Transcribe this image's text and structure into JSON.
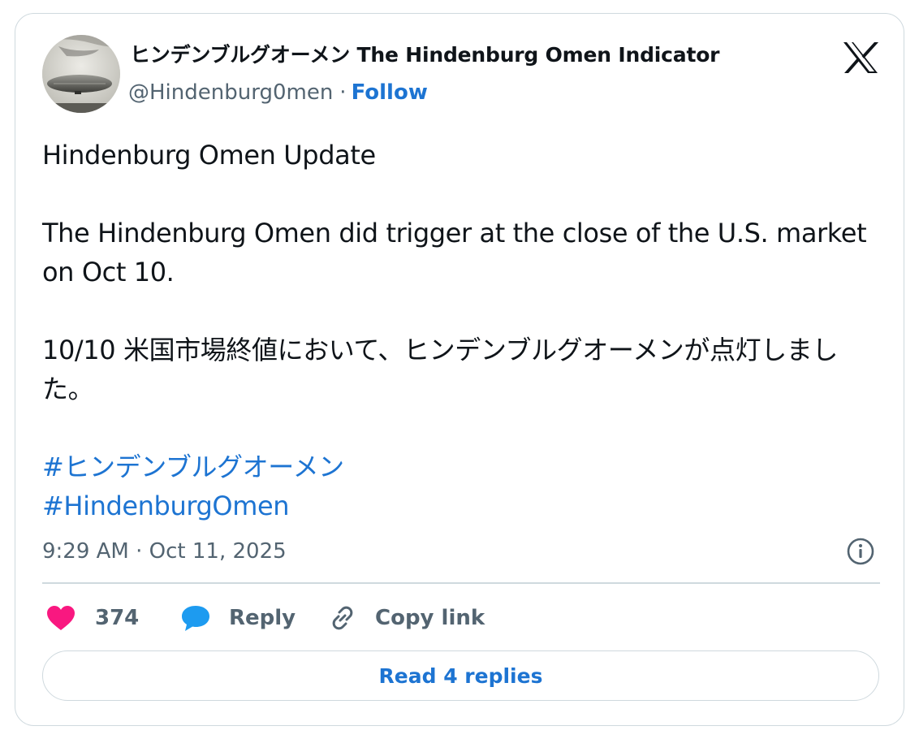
{
  "author": {
    "display_name": "ヒンデンブルグオーメン The Hindenburg Omen Indicator",
    "handle": "@Hindenburg0men",
    "separator": "·",
    "follow_label": "Follow"
  },
  "tweet": {
    "line1": "Hindenburg Omen Update",
    "line2": "The Hindenburg Omen did trigger at the close of the U.S. market on Oct 10.",
    "line3": "10/10 米国市場終値において、ヒンデンブルグオーメンが点灯しました。",
    "hashtags": [
      "#ヒンデンブルグオーメン",
      "#HindenburgOmen"
    ],
    "timestamp": "9:29 AM · Oct 11, 2025"
  },
  "actions": {
    "like_count": "374",
    "reply_label": "Reply",
    "copy_link_label": "Copy link"
  },
  "footer": {
    "read_replies_label": "Read 4 replies"
  },
  "icons": {
    "avatar": "zeppelin-photo",
    "x_logo": "x-logo-icon",
    "info": "info-icon",
    "like": "heart-icon",
    "reply": "speech-bubble-icon",
    "copy": "link-icon"
  },
  "colors": {
    "accent": "#1d74d2",
    "heart": "#f91880",
    "reply_bubble": "#1d9bf0",
    "secondary_text": "#536471",
    "border": "#cfd9de"
  }
}
